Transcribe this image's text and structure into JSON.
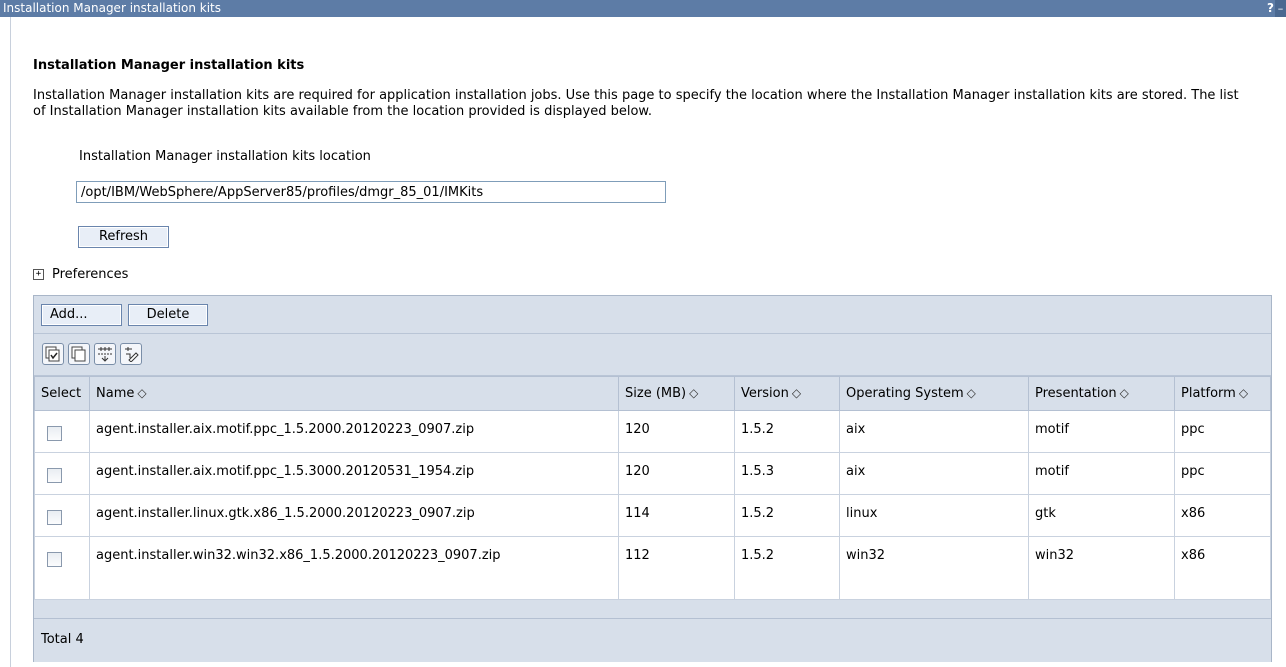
{
  "window": {
    "title": "Installation Manager installation kits",
    "help_label": "?",
    "minimize_label": "–"
  },
  "page": {
    "heading": "Installation Manager installation kits",
    "description": "Installation Manager installation kits are required for application installation jobs. Use this page to specify the location where the Installation Manager installation kits are stored. The list of Installation Manager installation kits available from the location provided is displayed below.",
    "location_label": "Installation Manager installation kits location",
    "location_value": "/opt/IBM/WebSphere/AppServer85/profiles/dmgr_85_01/IMKits",
    "refresh_label": "Refresh",
    "preferences_label": "Preferences"
  },
  "toolbar": {
    "add_label": "Add...",
    "delete_label": "Delete",
    "icons": [
      "select-all-icon",
      "deselect-all-icon",
      "show-filter-icon",
      "clear-filter-icon"
    ]
  },
  "table": {
    "columns": [
      "Select",
      "Name",
      "Size (MB)",
      "Version",
      "Operating System",
      "Presentation",
      "Platform"
    ],
    "sort_glyph": "◇",
    "rows": [
      {
        "name": "agent.installer.aix.motif.ppc_1.5.2000.20120223_0907.zip",
        "size": "120",
        "version": "1.5.2",
        "os": "aix",
        "presentation": "motif",
        "platform": "ppc"
      },
      {
        "name": "agent.installer.aix.motif.ppc_1.5.3000.20120531_1954.zip",
        "size": "120",
        "version": "1.5.3",
        "os": "aix",
        "presentation": "motif",
        "platform": "ppc"
      },
      {
        "name": "agent.installer.linux.gtk.x86_1.5.2000.20120223_0907.zip",
        "size": "114",
        "version": "1.5.2",
        "os": "linux",
        "presentation": "gtk",
        "platform": "x86"
      },
      {
        "name": "agent.installer.win32.win32.x86_1.5.2000.20120223_0907.zip",
        "size": "112",
        "version": "1.5.2",
        "os": "win32",
        "presentation": "win32",
        "platform": "x86"
      }
    ],
    "total_label": "Total 4"
  }
}
